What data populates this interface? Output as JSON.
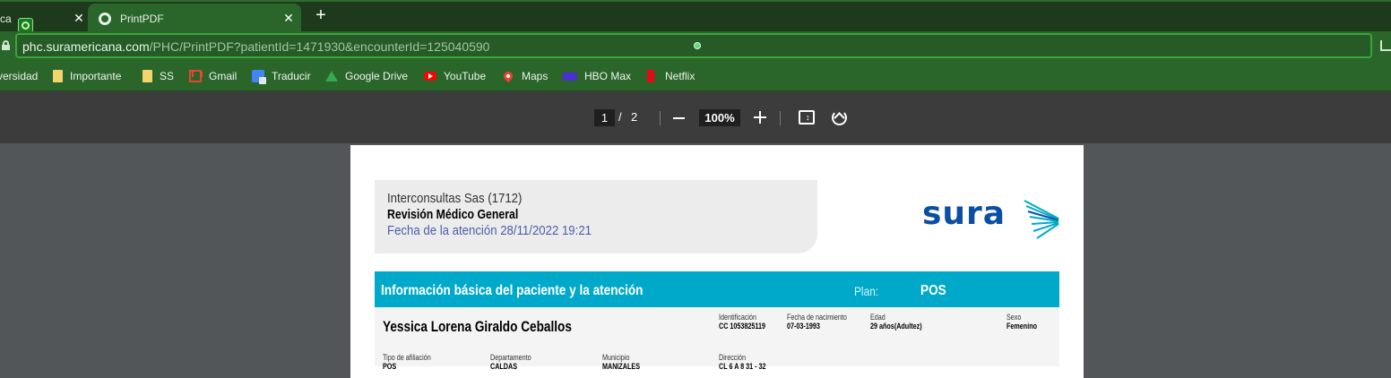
{
  "tabs": {
    "inactive_title": "ca",
    "active_title": "PrintPDF",
    "close_glyph": "✕",
    "new_tab_glyph": "+"
  },
  "address": {
    "domain": "phc.suramericana.com",
    "path": "/PHC/PrintPDF?patientId=1471930&encounterId=125040590"
  },
  "bookmarks": [
    {
      "label": "versidad",
      "icon": "none"
    },
    {
      "label": "Importante",
      "icon": "folder-icon"
    },
    {
      "label": "SS",
      "icon": "folder-icon"
    },
    {
      "label": "Gmail",
      "icon": "gmail-icon"
    },
    {
      "label": "Traducir",
      "icon": "translate-icon"
    },
    {
      "label": "Google Drive",
      "icon": "drive-icon"
    },
    {
      "label": "YouTube",
      "icon": "youtube-icon"
    },
    {
      "label": "Maps",
      "icon": "maps-icon"
    },
    {
      "label": "HBO Max",
      "icon": "hbo-icon"
    },
    {
      "label": "Netflix",
      "icon": "netflix-icon"
    }
  ],
  "pdf_toolbar": {
    "current_page": "1",
    "separator": "/",
    "total_pages": "2",
    "zoom": "100%"
  },
  "document": {
    "header_line1": "Interconsultas  Sas (1712)",
    "header_line2": "Revisión Médico General",
    "header_line3": "Fecha de la atención 28/11/2022 19:21",
    "logo_text": "sura",
    "section_title": "Información básica del paciente y la atención",
    "plan_label": "Plan:",
    "plan_value": "POS",
    "patient_name": "Yessica Lorena Giraldo Ceballos",
    "fields": {
      "id_label": "Identificación",
      "id_value": "CC 1053825119",
      "dob_label": "Fecha de nacimiento",
      "dob_value": "07-03-1993",
      "age_label": "Edad",
      "age_value": "29 años(Adultez)",
      "sex_label": "Sexo",
      "sex_value": "Femenino",
      "affiliation_label": "Tipo de afiliación",
      "affiliation_value": "POS",
      "department_label": "Departamento",
      "department_value": "CALDAS",
      "municipality_label": "Municipio",
      "municipality_value": "MANIZALES",
      "address_label": "Dirección",
      "address_value": "CL 6 A 8 31 - 32"
    }
  },
  "colors": {
    "tab_bar": "#1d3a1d",
    "chrome_green": "#2a652a",
    "pdf_toolbar": "#3c3c3c",
    "viewer_bg": "#525659",
    "section_bar": "#00a9c9",
    "sura_blue": "#0b4fa3",
    "sura_teal": "#00a9c9"
  }
}
